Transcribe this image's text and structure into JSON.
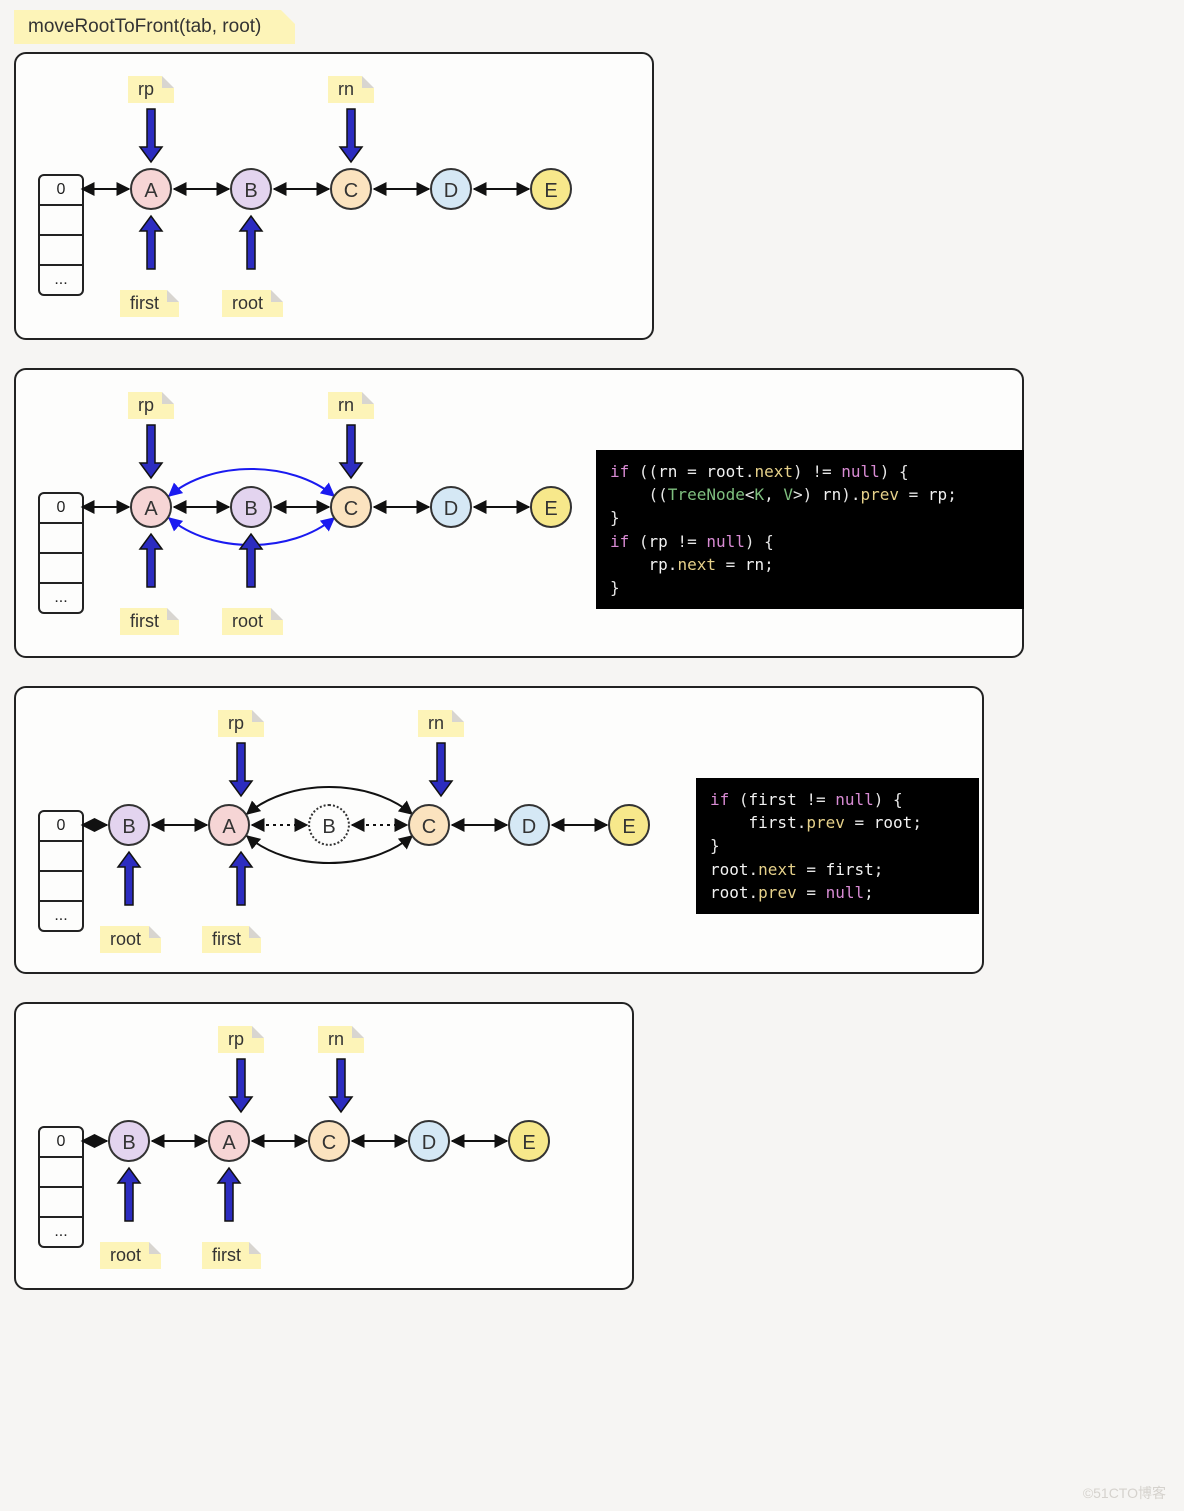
{
  "title": "moveRootToFront(tab, root)",
  "buckets": [
    "0",
    "",
    "",
    "..."
  ],
  "nodes": {
    "A": "A",
    "B": "B",
    "C": "C",
    "D": "D",
    "E": "E"
  },
  "labels": {
    "rp": "rp",
    "rn": "rn",
    "first": "first",
    "root": "root"
  },
  "panel1": {
    "order": [
      "A",
      "B",
      "C",
      "D",
      "E"
    ],
    "top": {
      "A": "rp",
      "C": "rn"
    },
    "bottom": {
      "A": "first",
      "B": "root"
    }
  },
  "panel2": {
    "order": [
      "A",
      "B",
      "C",
      "D",
      "E"
    ],
    "top": {
      "A": "rp",
      "C": "rn"
    },
    "bottom": {
      "A": "first",
      "B": "root"
    },
    "curve_ac": true,
    "code": [
      [
        [
          "kw",
          "if"
        ],
        [
          "pn",
          " (("
        ],
        [
          "var",
          "rn"
        ],
        [
          "pn",
          " = "
        ],
        [
          "var",
          "root"
        ],
        [
          "pn",
          "."
        ],
        [
          "mth",
          "next"
        ],
        [
          "pn",
          ") != "
        ],
        [
          "nul",
          "null"
        ],
        [
          "pn",
          ") {"
        ]
      ],
      [
        [
          "pn",
          "    (("
        ],
        [
          "typ",
          "TreeNode"
        ],
        [
          "pn",
          "<"
        ],
        [
          "typ",
          "K"
        ],
        [
          "pn",
          ", "
        ],
        [
          "typ",
          "V"
        ],
        [
          "pn",
          ">) "
        ],
        [
          "var",
          "rn"
        ],
        [
          "pn",
          ")."
        ],
        [
          "mth",
          "prev"
        ],
        [
          "pn",
          " = "
        ],
        [
          "var",
          "rp"
        ],
        [
          "pn",
          ";"
        ]
      ],
      [
        [
          "pn",
          "}"
        ]
      ],
      [
        [
          "kw",
          "if"
        ],
        [
          "pn",
          " ("
        ],
        [
          "var",
          "rp"
        ],
        [
          "pn",
          " != "
        ],
        [
          "nul",
          "null"
        ],
        [
          "pn",
          ") {"
        ]
      ],
      [
        [
          "pn",
          "    "
        ],
        [
          "var",
          "rp"
        ],
        [
          "pn",
          "."
        ],
        [
          "mth",
          "next"
        ],
        [
          "pn",
          " = "
        ],
        [
          "var",
          "rn"
        ],
        [
          "pn",
          ";"
        ]
      ],
      [
        [
          "pn",
          "}"
        ]
      ]
    ]
  },
  "panel3": {
    "order": [
      "B",
      "A",
      "B_ghost",
      "C",
      "D",
      "E"
    ],
    "top": {
      "A": "rp",
      "C": "rn"
    },
    "bottom": {
      "B": "root",
      "A": "first"
    },
    "curve_a_c_around_ghost": true,
    "code": [
      [
        [
          "kw",
          "if"
        ],
        [
          "pn",
          " ("
        ],
        [
          "var",
          "first"
        ],
        [
          "pn",
          " != "
        ],
        [
          "nul",
          "null"
        ],
        [
          "pn",
          ") {"
        ]
      ],
      [
        [
          "pn",
          "    "
        ],
        [
          "var",
          "first"
        ],
        [
          "pn",
          "."
        ],
        [
          "mth",
          "prev"
        ],
        [
          "pn",
          " = "
        ],
        [
          "var",
          "root"
        ],
        [
          "pn",
          ";"
        ]
      ],
      [
        [
          "pn",
          "}"
        ]
      ],
      [
        [
          "var",
          "root"
        ],
        [
          "pn",
          "."
        ],
        [
          "mth",
          "next"
        ],
        [
          "pn",
          " = "
        ],
        [
          "var",
          "first"
        ],
        [
          "pn",
          ";"
        ]
      ],
      [
        [
          "var",
          "root"
        ],
        [
          "pn",
          "."
        ],
        [
          "mth",
          "prev"
        ],
        [
          "pn",
          " = "
        ],
        [
          "nul",
          "null"
        ],
        [
          "pn",
          ";"
        ]
      ]
    ]
  },
  "panel4": {
    "order": [
      "B",
      "A",
      "C",
      "D",
      "E"
    ],
    "top": {
      "A": "rp",
      "C": "rn"
    },
    "bottom": {
      "B": "root",
      "A": "first"
    }
  },
  "watermark": "©51CTO博客"
}
